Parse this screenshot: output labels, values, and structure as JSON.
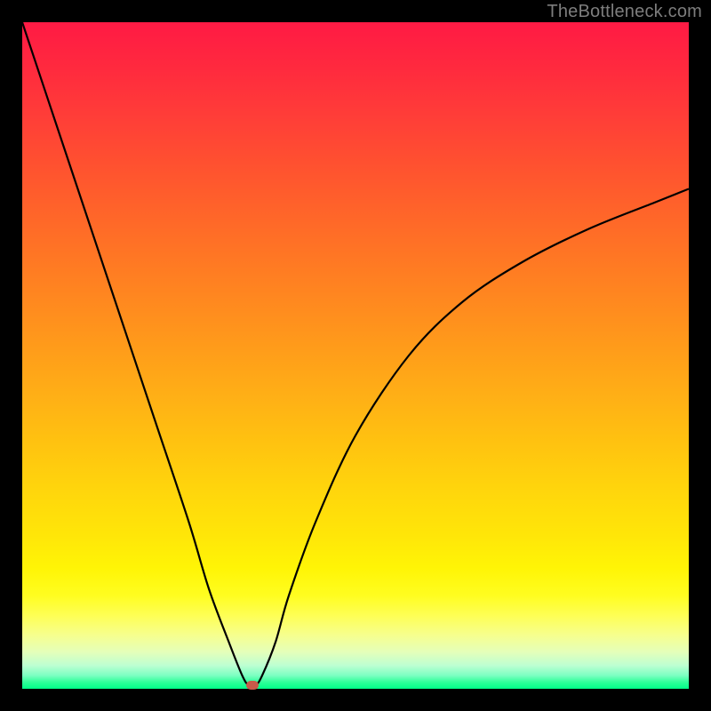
{
  "watermark": "TheBottleneck.com",
  "chart_data": {
    "type": "line",
    "title": "",
    "xlabel": "",
    "ylabel": "",
    "xlim": [
      0,
      100
    ],
    "ylim": [
      0,
      100
    ],
    "grid": false,
    "series": [
      {
        "name": "bottleneck-curve",
        "x": [
          0,
          5,
          10,
          15,
          20,
          25,
          28,
          31,
          33,
          34,
          35,
          36,
          38,
          40,
          44,
          50,
          58,
          66,
          75,
          85,
          95,
          100
        ],
        "y": [
          100,
          85,
          70,
          55,
          40,
          25,
          15,
          7,
          2,
          0.5,
          0.5,
          2,
          7,
          14,
          25,
          38,
          50,
          58,
          64,
          69,
          73,
          75
        ]
      }
    ],
    "marker": {
      "x": 34.5,
      "y": 0.5,
      "color": "#c85a4a"
    },
    "gradient_stops": [
      {
        "pos": 0,
        "color": "#ff1a44"
      },
      {
        "pos": 50,
        "color": "#ff9c1a"
      },
      {
        "pos": 80,
        "color": "#fff506"
      },
      {
        "pos": 100,
        "color": "#00ff88"
      }
    ]
  }
}
